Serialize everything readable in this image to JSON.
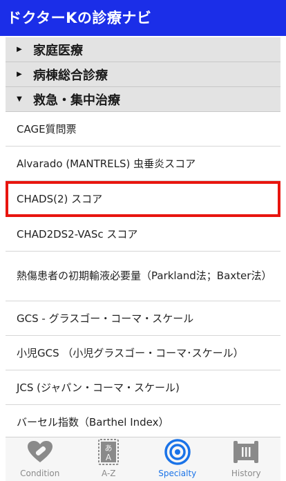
{
  "header": {
    "title": "ドクターKの診療ナビ"
  },
  "categories": [
    {
      "label": "家庭医療",
      "expanded": false
    },
    {
      "label": "病棟総合診療",
      "expanded": false
    },
    {
      "label": "救急・集中治療",
      "expanded": true
    }
  ],
  "items": [
    "CAGE質問票",
    "Alvarado (MANTRELS) 虫垂炎スコア",
    "CHADS(2) スコア",
    "CHAD2DS2-VASc スコア",
    "熱傷患者の初期輸液必要量（Parkland法；Baxter法）",
    "GCS - グラスゴー・コーマ・スケール",
    "小児GCS （小児グラスゴー・コーマ･スケール）",
    "JCS (ジャパン・コーマ・スケール)",
    "バーセル指数（Barthel Index）"
  ],
  "tabs": [
    {
      "label": "Condition",
      "active": false
    },
    {
      "label": "A-Z",
      "active": false,
      "icon_text_top": "あ",
      "icon_text_bottom": "A"
    },
    {
      "label": "Specialty",
      "active": true
    },
    {
      "label": "History",
      "active": false
    }
  ],
  "colors": {
    "header": "#1b2ee8",
    "highlight": "#e8150f",
    "active_tab": "#1a73e8",
    "inactive_tab": "#8a8a8a"
  }
}
